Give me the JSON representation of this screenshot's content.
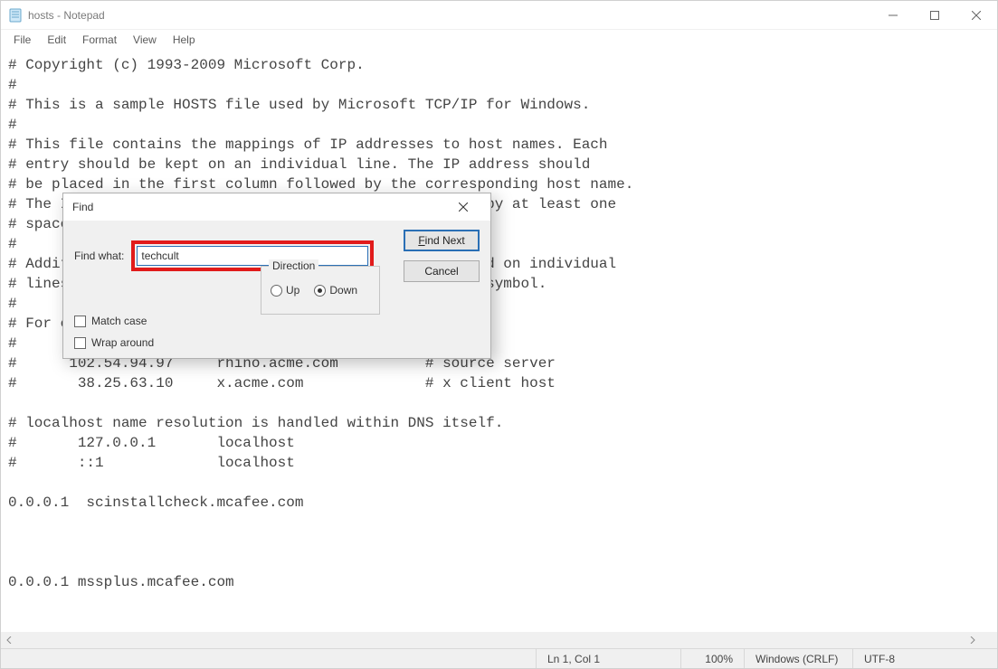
{
  "window": {
    "title": "hosts - Notepad"
  },
  "menu": {
    "file": "File",
    "edit": "Edit",
    "format": "Format",
    "view": "View",
    "help": "Help"
  },
  "editor_text": "# Copyright (c) 1993-2009 Microsoft Corp.\n#\n# This is a sample HOSTS file used by Microsoft TCP/IP for Windows.\n#\n# This file contains the mappings of IP addresses to host names. Each\n# entry should be kept on an individual line. The IP address should\n# be placed in the first column followed by the corresponding host name.\n# The IP address and the host name should be separated by at least one\n# space.\n#\n# Additionally, comments (such as these) may be inserted on individual\n# lines or following the machine name denoted by a '#' symbol.\n#\n# For example:\n#\n#      102.54.94.97     rhino.acme.com          # source server\n#       38.25.63.10     x.acme.com              # x client host\n\n# localhost name resolution is handled within DNS itself.\n#       127.0.0.1       localhost\n#       ::1             localhost\n\n0.0.0.1  scinstallcheck.mcafee.com\n\n\n\n0.0.0.1 mssplus.mcafee.com",
  "find": {
    "title": "Find",
    "label": "Find what:",
    "value": "techcult",
    "find_next_pre": "F",
    "find_next_post": "ind Next",
    "cancel": "Cancel",
    "match_case_pre": "Match ",
    "match_case_u": "c",
    "match_case_post": "ase",
    "wrap_pre": "W",
    "wrap_u": "r",
    "wrap_post": "ap around",
    "direction": "Direction",
    "up_u": "U",
    "up_post": "p",
    "down_u": "D",
    "down_post": "own"
  },
  "status": {
    "position": "Ln 1, Col 1",
    "zoom": "100%",
    "encoding": "Windows (CRLF)",
    "charset": "UTF-8"
  }
}
